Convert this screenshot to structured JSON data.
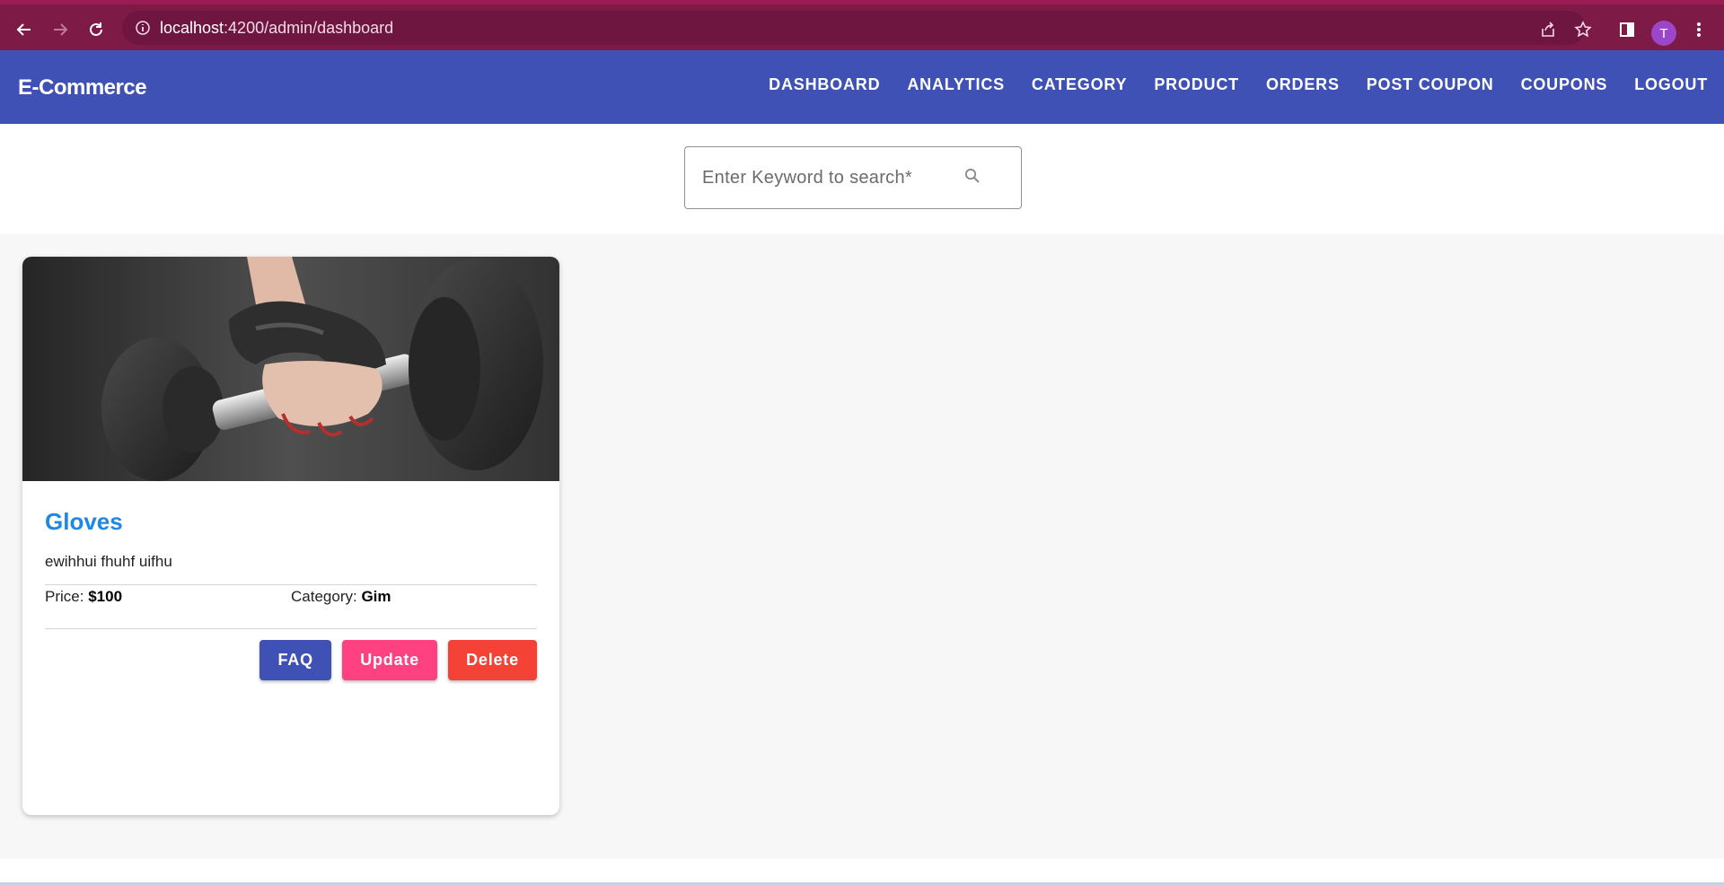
{
  "browser": {
    "url_host": "localhost",
    "url_rest": ":4200/admin/dashboard",
    "profile_initial": "T",
    "icons": [
      "back-arrow-icon",
      "forward-arrow-icon",
      "reload-icon",
      "site-info-icon",
      "share-icon",
      "star-icon",
      "side-panel-icon",
      "kebab-menu-icon"
    ]
  },
  "toolbar": {
    "brand": "E-Commerce",
    "nav": [
      "DASHBOARD",
      "ANALYTICS",
      "CATEGORY",
      "PRODUCT",
      "ORDERS",
      "POST COUPON",
      "COUPONS",
      "LOGOUT"
    ],
    "active": "DASHBOARD"
  },
  "search": {
    "placeholder": "Enter Keyword to search*",
    "value": "",
    "icon": "search-icon"
  },
  "products": [
    {
      "image_alt": "hand with glove holding dumbbell",
      "title": "Gloves",
      "description": "ewihhui fhuhf uifhu",
      "price_label": "Price:",
      "price": "$100",
      "category_label": "Category:",
      "category": "Gim",
      "buttons": {
        "faq": "FAQ",
        "update": "Update",
        "delete": "Delete"
      }
    }
  ],
  "colors": {
    "chrome": "#7d1a45",
    "toolbar": "#3f51b5",
    "title": "#1e88e5",
    "faq": "#3f51b5",
    "update": "#ff4081",
    "delete": "#f44336"
  }
}
